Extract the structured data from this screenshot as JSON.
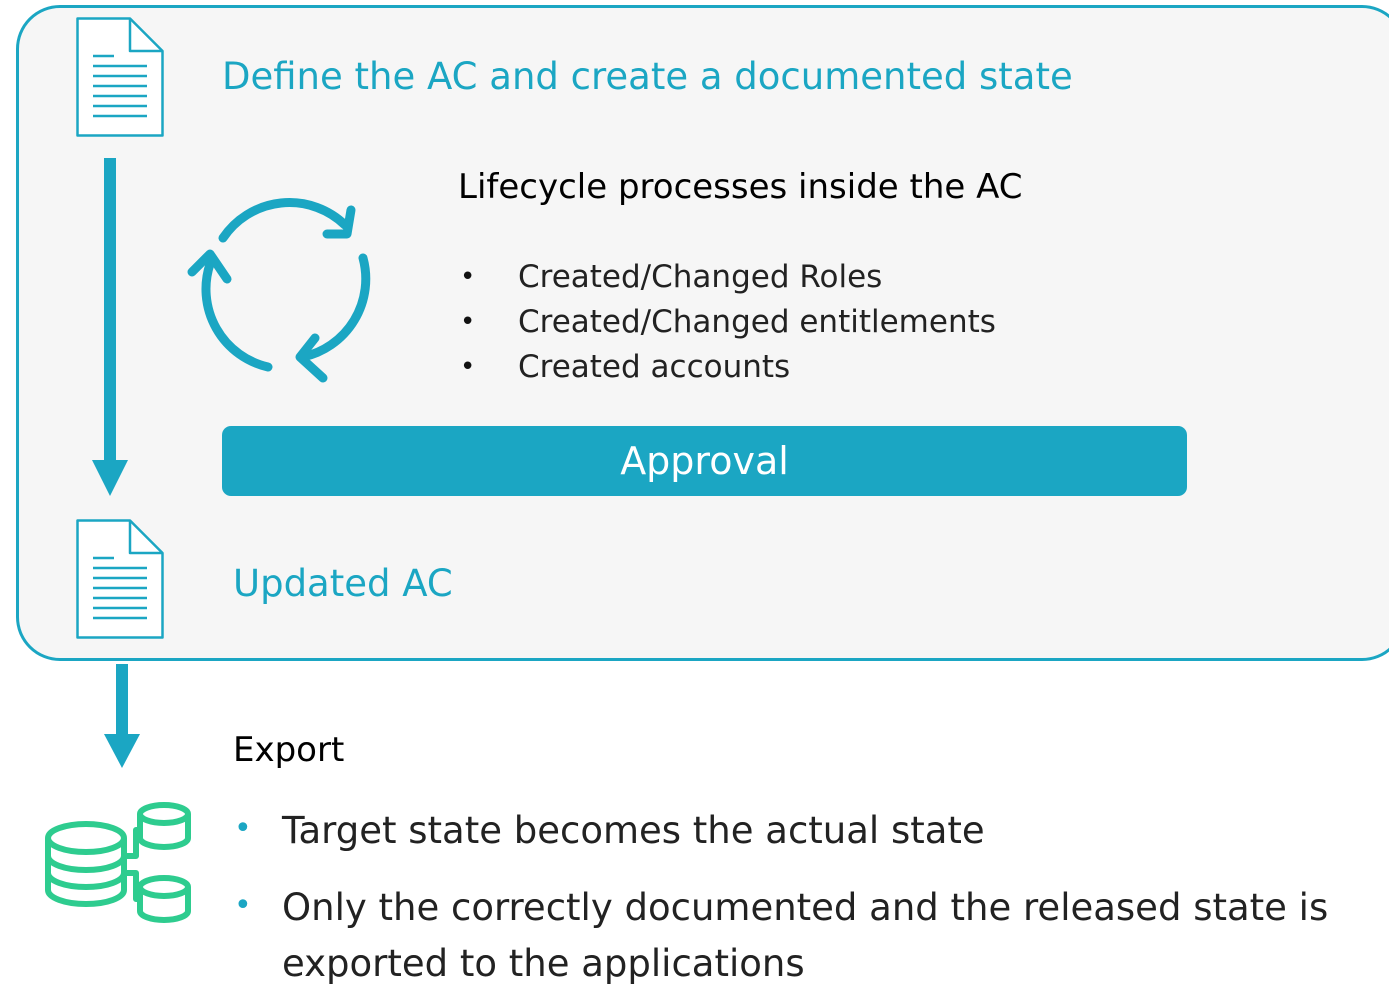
{
  "colors": {
    "accent": "#1ba6c3",
    "database": "#2ecc8f",
    "panel_bg": "#f6f6f6"
  },
  "icons": {
    "doc_top": "document-icon",
    "doc_bottom": "document-icon",
    "cycle": "cycle-arrows-icon",
    "database": "database-icon"
  },
  "define_title": "Define the AC and create a documented state",
  "lifecycle": {
    "heading": "Lifecycle processes inside the AC",
    "items": [
      "Created/Changed Roles",
      "Created/Changed entitlements",
      "Created accounts"
    ]
  },
  "approval_label": "Approval",
  "updated_title": "Updated AC",
  "export": {
    "heading": "Export",
    "items": [
      "Target state becomes the actual state",
      "Only the correctly documented and the released state is",
      "exported to the applications"
    ]
  }
}
